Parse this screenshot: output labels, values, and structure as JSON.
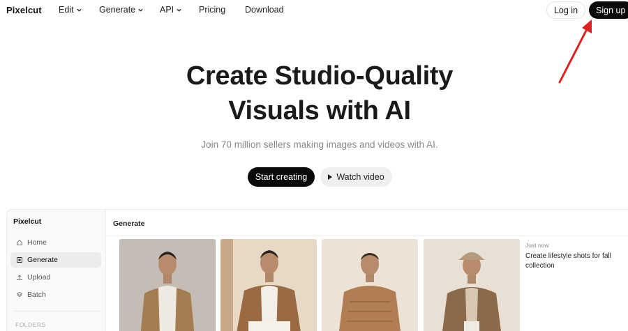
{
  "nav": {
    "brand": "Pixelcut",
    "items": [
      {
        "label": "Edit",
        "dropdown": true
      },
      {
        "label": "Generate",
        "dropdown": true
      },
      {
        "label": "API",
        "dropdown": true
      },
      {
        "label": "Pricing",
        "dropdown": false
      },
      {
        "label": "Download",
        "dropdown": false
      }
    ],
    "login": "Log in",
    "signup": "Sign up"
  },
  "hero": {
    "title_line1": "Create Studio-Quality",
    "title_line2": "Visuals with AI",
    "subtitle": "Join 70 million sellers making images and videos with AI.",
    "start": "Start creating",
    "watch": "Watch video"
  },
  "app": {
    "brand": "Pixelcut",
    "sidebar": [
      {
        "label": "Home",
        "icon": "home-icon",
        "active": false
      },
      {
        "label": "Generate",
        "icon": "generate-icon",
        "active": true
      },
      {
        "label": "Upload",
        "icon": "upload-icon",
        "active": false
      },
      {
        "label": "Batch",
        "icon": "batch-icon",
        "active": false
      }
    ],
    "folders": "FOLDERS",
    "main_title": "Generate",
    "status": "Just now",
    "prompt": "Create lifestyle shots for fall collection"
  },
  "colors": {
    "accent_black": "#0a0a0a",
    "annotation_red": "#e02020",
    "coat_brown": "#a67c52"
  }
}
